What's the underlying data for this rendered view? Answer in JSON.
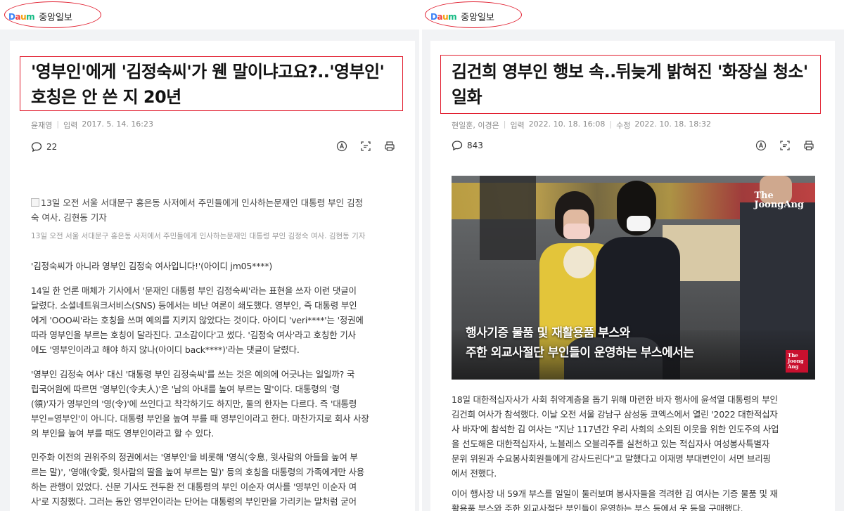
{
  "left": {
    "brand": {
      "daum": "Daum",
      "name": "중앙일보"
    },
    "headline": "'영부인'에게 '김정숙씨'가 웬 말이냐고요?..'영부인' 호칭은 안 쓴 지 20년",
    "headline_lines": [
      "'영부인'에게 '김정숙씨'가 웬 말이냐고요?..'영부인'",
      "호칭은 안 쓴 지 20년"
    ],
    "author": "윤재영",
    "date_label": "입력",
    "date": "2017. 5. 14. 16:23",
    "comments": "22",
    "image_alt_lines": [
      "13일 오전 서울 서대문구 홍은동 사저에서 주민들에게 인사하는문재인 대통령 부인 김정",
      "숙 여사. 김현동 기자"
    ],
    "image_caption": "13일 오전 서울 서대문구 홍은동 사저에서 주민들에게 인사하는문재인 대통령 부인 김정숙 여사. 김현동 기자",
    "quote": "'김정숙씨가 아니라 영부인 김정숙 여사입니다!'(아이디 jm05****)",
    "para1": [
      "14일 한 언론 매체가 기사에서 '문재인 대통령 부인 김정숙씨'라는 표현을 쓰자 이런 댓글이",
      "달렸다. 소셜네트워크서비스(SNS) 등에서는 비난 여론이 쇄도했다. 영부인, 즉 대통령 부인",
      "에게 'OOO씨'라는 호칭을 쓰며 예의를 지키지 않았다는 것이다. 아이디 'veri****'는 '정권에",
      "따라 영부인을 부르는 호칭이 달라진다. 고소감이다'고 썼다. '김정숙 여사'라고 호칭한 기사",
      "에도 '영부인이라고 해야 하지 않나(아이디 back****)'라는 댓글이 달렸다."
    ],
    "para2": [
      "'영부인 김정숙 여사' 대신 '대통령 부인 김정숙씨'를 쓰는 것은 예의에 어긋나는 일일까? 국",
      "립국어원에 따르면 '영부인(令夫人)'은 '남의 아내를 높여 부르는 말'이다. 대통령의 '령",
      "(領)'자가 영부인의 '영(令)'에 쓰인다고 착각하기도 하지만, 둘의 한자는 다르다. 즉 '대통령",
      "부인=영부인'이 아니다. 대통령 부인을 높여 부를 때 영부인이라고 한다. 마찬가지로 회사 사장",
      "의 부인을 높여 부를 때도 영부인이라고 할 수 있다."
    ],
    "para3": [
      "민주화 이전의 권위주의 정권에서는 '영부인'을 비롯해 '영식(令息, 윗사람의 아들을 높여 부",
      "르는 말)', '영애(令愛, 윗사람의 딸을 높여 부르는 말)' 등의 호칭을 대통령의 가족에게만 사용",
      "하는 관행이 있었다. 신문 기사도 전두환 전 대통령의 부인 이순자 여사를 '영부인 이순자 여",
      "사'로 지칭했다. 그러는 동안 영부인이라는 단어는 대통령의 부인만을 가리키는 말처럼 굳어"
    ]
  },
  "right": {
    "brand": {
      "daum": "Daum",
      "name": "중앙일보"
    },
    "headline": "김건희 영부인 행보 속..뒤늦게 밝혀진 '화장실 청소' 일화",
    "headline_lines": [
      "김건희 영부인 행보 속..뒤늦게 밝혀진 '화장실 청소'",
      "일화"
    ],
    "authors": "현일훈, 이경은",
    "date_label": "입력",
    "date": "2022. 10. 18. 16:08",
    "modified_label": "수정",
    "modified": "2022. 10. 18. 18:32",
    "comments": "843",
    "photo_logo": [
      "The",
      "JoongAng"
    ],
    "photo_logo_small": [
      "The",
      "Joong",
      "Ang"
    ],
    "photo_overlay": [
      "행사기증 물품 및 재활용품 부스와",
      "주한 외교사절단 부인들이 운영하는 부스에서는"
    ],
    "para1": [
      "18일 대한적십자사가 사회 취약계층을 돕기 위해 마련한 바자 행사에 윤석열 대통령의 부인",
      "김건희 여사가 참석했다. 이날 오전 서울 강남구 삼성동 코엑스에서 열린 '2022 대한적십자",
      "사 바자'에 참석한 김 여사는 \"지난 117년간 우리 사회의 소외된 이웃을 위한 인도주의 사업",
      "을 선도해온 대한적십자사, 노블레스 오블리주를 실천하고 있는 적십자사 여성봉사특별자",
      "문위 위원과 수요봉사회원들에게 감사드린다\"고 말했다고 이재명 부대변인이 서면 브리핑",
      "에서 전했다."
    ],
    "para2": [
      "이어 행사장 내 59개 부스를 일일이 둘러보며 봉사자들을 격려한 김 여사는 기증 물품 및 재",
      "활용품 부스와 주한 외교사절단 부인들이 운영하는 부스 등에서 옷 등을 구매했다."
    ]
  },
  "colors": {
    "highlight": "#e11d2e",
    "meta": "#888888",
    "text": "#333333"
  },
  "icons": [
    "comment-icon",
    "translate-icon",
    "summary-icon",
    "print-icon"
  ]
}
